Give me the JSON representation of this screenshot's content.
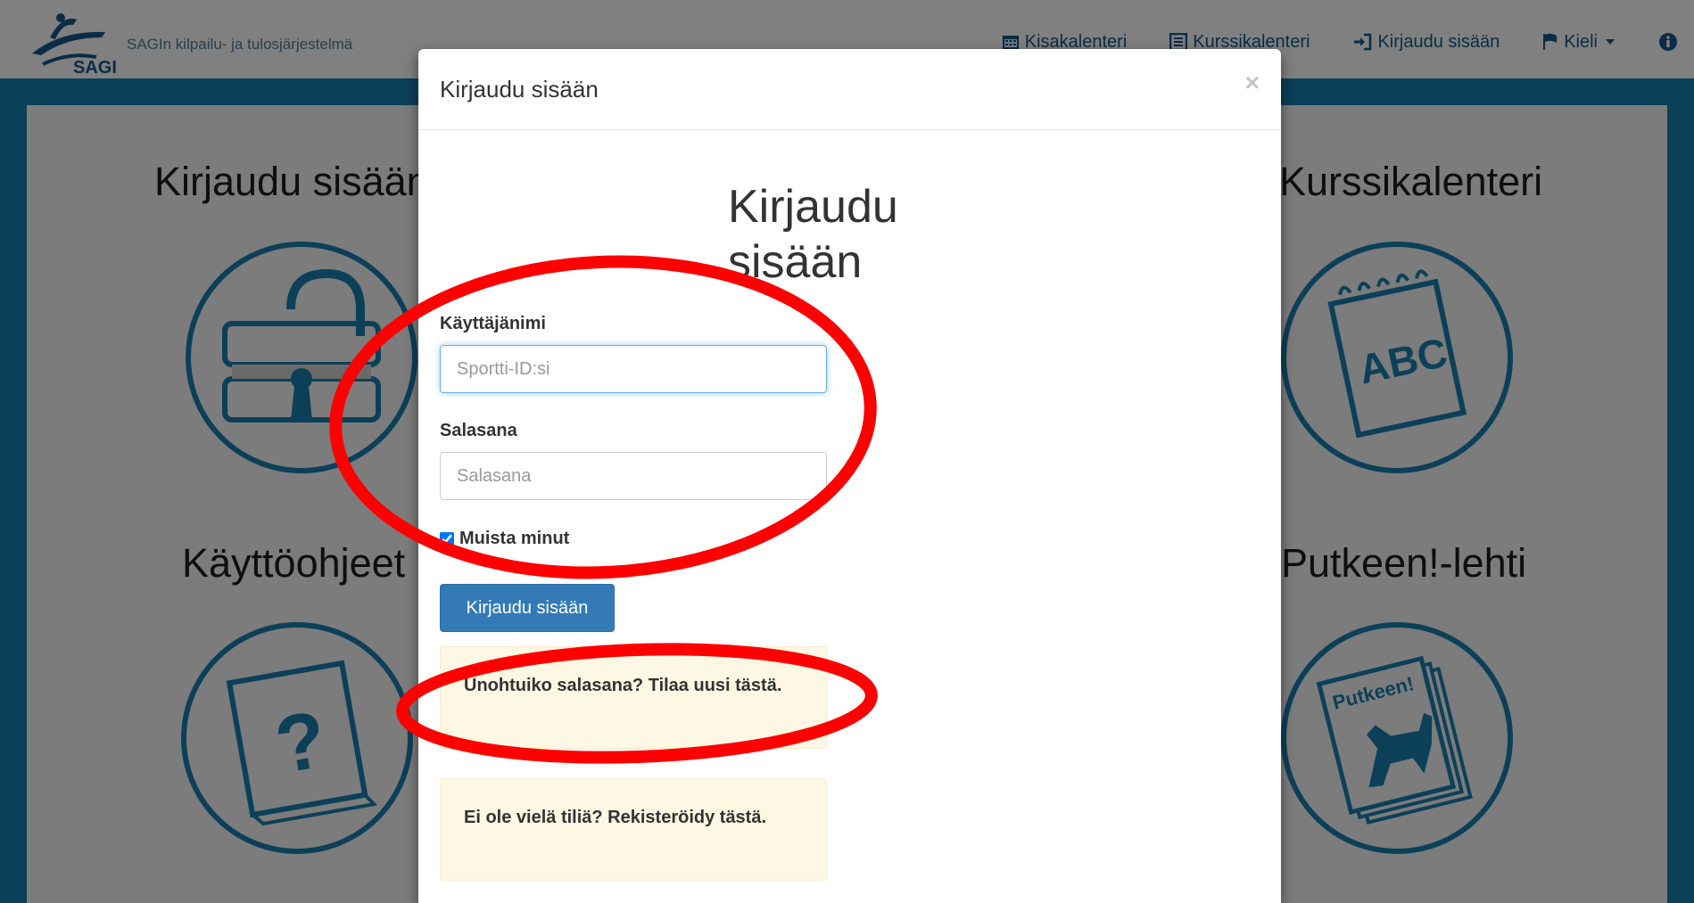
{
  "navbar": {
    "brand_logo_text": "SAGI",
    "brand_text": "SAGIn kilpailu- ja tulosjärjestelmä",
    "items": [
      {
        "icon": "calendar-icon",
        "label": "Kisakalenteri"
      },
      {
        "icon": "list-icon",
        "label": "Kurssikalenteri"
      },
      {
        "icon": "sign-in-icon",
        "label": "Kirjaudu sisään"
      },
      {
        "icon": "flag-icon",
        "label": "Kieli"
      }
    ],
    "info_icon": "info-icon"
  },
  "background_tiles": {
    "login_title": "Kirjaudu sisään",
    "courses_title": "Kurssikalenteri",
    "courses_icon_text": "ABC",
    "manual_title": "Käyttöohjeet",
    "manual_icon_text": "?",
    "magazine_title": "Putkeen!-lehti",
    "magazine_icon_text": "Putkeen!"
  },
  "modal": {
    "title": "Kirjaudu sisään",
    "close_label": "×",
    "heading": "Kirjaudu sisään",
    "username_label": "Käyttäjänimi",
    "username_placeholder": "Sportti-ID:si",
    "password_label": "Salasana",
    "password_placeholder": "Salasana",
    "remember_label": "Muista minut",
    "remember_checked": true,
    "submit_label": "Kirjaudu sisään",
    "forgot_text": "Unohtuiko salasana? Tilaa uusi tästä.",
    "register_text": "Ei ole vielä tiliä? Rekisteröidy tästä."
  },
  "colors": {
    "primary": "#337ab7",
    "alert_bg": "#fcf8e3",
    "annotation": "#ff0000",
    "page_band": "#0c4058"
  }
}
